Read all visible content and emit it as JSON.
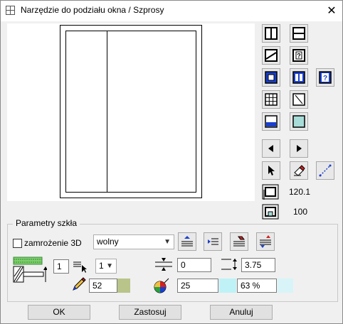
{
  "window": {
    "title": "Narzędzie do podziału okna / Szprosy",
    "close_glyph": "✕"
  },
  "toolbar": {
    "buttons": [
      {
        "name": "divide-vertical-icon"
      },
      {
        "name": "divide-horizontal-icon"
      },
      {
        "name": "diagonal-bar-icon"
      },
      {
        "name": "custom-division-icon"
      },
      {
        "name": "frame-square-icon"
      },
      {
        "name": "double-panel-icon"
      },
      {
        "name": "custom-division-dark-icon"
      },
      {
        "name": "grid-icon"
      },
      {
        "name": "diagonal-frame-icon"
      },
      {
        "name": "bottom-fill-icon"
      },
      {
        "name": "glass-fill-icon"
      },
      {
        "name": "arrow-left-icon"
      },
      {
        "name": "arrow-right-icon"
      },
      {
        "name": "cursor-icon"
      },
      {
        "name": "eraser-icon"
      },
      {
        "name": "dashed-line-icon"
      }
    ],
    "size_width_value": "120.1",
    "size_height_value": "100"
  },
  "glass_params": {
    "group_title": "Parametry szkła",
    "freeze_3d_label": "zamrożenie 3D",
    "mode_select_value": "wolny",
    "pane_count_value": "1",
    "layer_select_value": "1",
    "gap_value": "0",
    "thickness_value": "3.75",
    "color_value": "52",
    "transparency_value": "25",
    "opacity_value": "63 %"
  },
  "colors": {
    "accent_blue": "#1a3fcc",
    "glass_fill": "#a8dcd8",
    "color_swatch": "#b8c48a",
    "transparency_swatch": "#bff2f6",
    "opacity_swatch": "#d8f4f8"
  },
  "footer": {
    "ok_label": "OK",
    "apply_label": "Zastosuj",
    "cancel_label": "Anuluj"
  }
}
